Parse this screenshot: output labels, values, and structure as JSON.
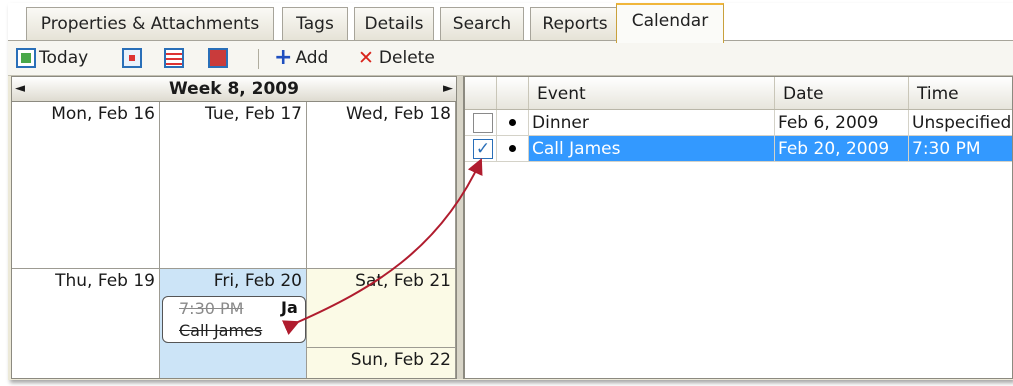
{
  "tabs": [
    {
      "label": "Properties & Attachments"
    },
    {
      "label": "Tags"
    },
    {
      "label": "Details"
    },
    {
      "label": "Search"
    },
    {
      "label": "Reports"
    },
    {
      "label": "Calendar",
      "active": true
    }
  ],
  "toolbar": {
    "today_label": "Today",
    "add_label": "Add",
    "delete_label": "Delete"
  },
  "calendar": {
    "week_title": "Week 8, 2009",
    "prev_arrow": "◄",
    "next_arrow": "►",
    "days": {
      "mon": "Mon, Feb 16",
      "tue": "Tue, Feb 17",
      "wed": "Wed, Feb 18",
      "thu": "Thu, Feb 19",
      "fri": "Fri, Feb 20",
      "sat": "Sat, Feb 21",
      "sun": "Sun, Feb 22"
    },
    "event": {
      "time": "7:30 PM",
      "title": "Call James",
      "overflow": "Ja"
    },
    "selected_day_color": "#cce4f7",
    "weekend_color": "#fbfae6"
  },
  "grid": {
    "columns": [
      "Event",
      "Date",
      "Time"
    ],
    "rows": [
      {
        "checked": false,
        "event": "Dinner",
        "date": "Feb 6, 2009",
        "time": "Unspecified",
        "selected": false
      },
      {
        "checked": true,
        "event": "Call James",
        "date": "Feb 20, 2009",
        "time": "7:30 PM",
        "selected": true
      }
    ],
    "selection_color": "#3399ff"
  },
  "annotation_color": "#b01c2e"
}
